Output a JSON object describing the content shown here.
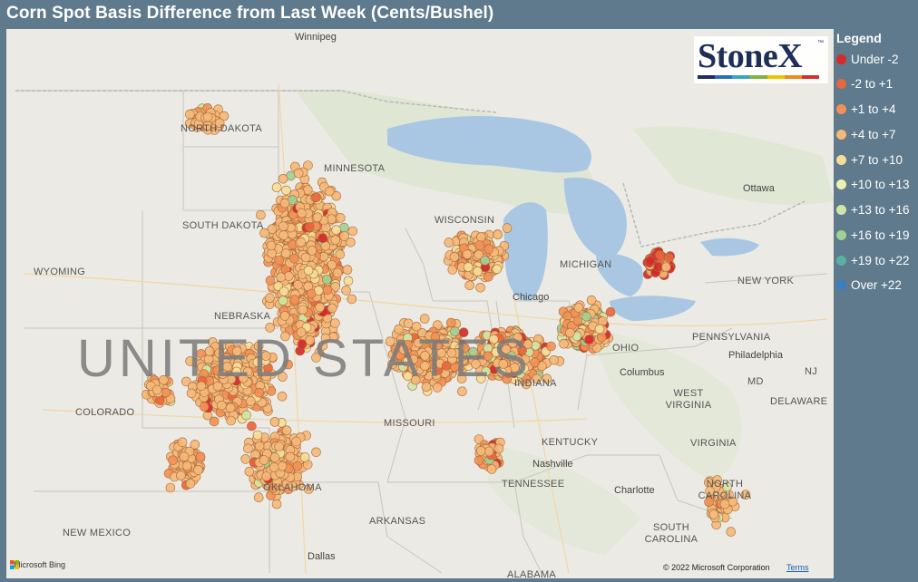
{
  "title": "Corn Spot Basis Difference from Last Week (Cents/Bushel)",
  "legend": {
    "title": "Legend",
    "items": [
      {
        "label": "Under -2",
        "color": "#d42a2a"
      },
      {
        "label": "-2 to +1",
        "color": "#e8673d"
      },
      {
        "label": "+1 to +4",
        "color": "#f29156"
      },
      {
        "label": "+4 to +7",
        "color": "#f4b979"
      },
      {
        "label": "+7 to +10",
        "color": "#f5dd98"
      },
      {
        "label": "+10 to +13",
        "color": "#eef0b0"
      },
      {
        "label": "+13 to +16",
        "color": "#cfe6a4"
      },
      {
        "label": "+16 to +19",
        "color": "#9fd095"
      },
      {
        "label": "+19 to +22",
        "color": "#5ab0a0"
      },
      {
        "label": "Over +22",
        "color": "#3a7fbf"
      }
    ]
  },
  "logo": {
    "text": "StoneX",
    "tm": "™",
    "stripe_colors": [
      "#1d2e58",
      "#2a6fb5",
      "#3ba3c8",
      "#7cb342",
      "#f2c200",
      "#f08a1c",
      "#d32f2f"
    ]
  },
  "map": {
    "watermark": "UNITED STATES",
    "places": {
      "winnipeg": "Winnipeg",
      "north_dakota": "NORTH DAKOTA",
      "minnesota": "MINNESOTA",
      "south_dakota": "SOUTH DAKOTA",
      "wyoming": "WYOMING",
      "nebraska": "NEBRASKA",
      "wisconsin": "WISCONSIN",
      "michigan": "MICHIGAN",
      "chicago": "Chicago",
      "indiana": "INDIANA",
      "ohio": "OHIO",
      "columbus": "Columbus",
      "colorado": "COLORADO",
      "missouri": "MISSOURI",
      "kentucky": "KENTUCKY",
      "nashville": "Nashville",
      "tennessee": "TENNESSEE",
      "oklahoma": "OKLAHOMA",
      "arkansas": "ARKANSAS",
      "new_mexico": "NEW MEXICO",
      "dallas": "Dallas",
      "alabama": "ALABAMA",
      "west_virginia": "WEST VIRGINIA",
      "virginia": "VIRGINIA",
      "north_carolina": "NORTH CAROLINA",
      "charlotte": "Charlotte",
      "south_carolina": "SOUTH CAROLINA",
      "pennsylvania": "PENNSYLVANIA",
      "philadelphia": "Philadelphia",
      "new_york": "NEW YORK",
      "ottawa": "Ottawa",
      "md": "MD",
      "delaware": "DELAWARE",
      "nj": "NJ"
    },
    "bing_label": "Microsoft Bing",
    "copyright": "© 2022 Microsoft Corporation",
    "terms": "Terms"
  }
}
